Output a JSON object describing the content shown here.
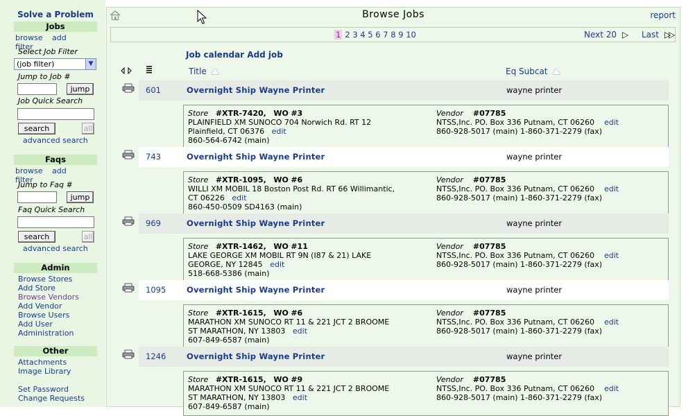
{
  "sidebar": {
    "solve": "Solve a Problem",
    "jobs": {
      "heading": "Jobs",
      "browse": "browse",
      "add": "add",
      "filter": "filter",
      "select_label": "Select Job Filter",
      "select_value": "(job filter)",
      "jump_label": "Jump to Job #",
      "jump_button": "jump",
      "quick_label": "Job Quick Search",
      "search_button": "search",
      "all_button": "all",
      "advanced": "advanced search"
    },
    "faqs": {
      "heading": "Faqs",
      "browse": "browse",
      "add": "add",
      "filter": "filter",
      "jump_label": "Jump to Faq #",
      "jump_button": "jump",
      "quick_label": "Faq Quick Search",
      "search_button": "search",
      "all_button": "all",
      "advanced": "advanced search"
    },
    "admin": {
      "heading": "Admin",
      "links": [
        "Browse Stores",
        "Add Store",
        "Browse Vendors",
        "Add Vendor",
        "Browse Users",
        "Add User",
        "Administration"
      ]
    },
    "other": {
      "heading": "Other",
      "links": [
        "Attachments",
        "Image Library",
        "Set Password",
        "Change Requests"
      ]
    }
  },
  "header": {
    "title": "Browse Jobs",
    "report": "report"
  },
  "pager": {
    "pages": [
      "1",
      "2",
      "3",
      "4",
      "5",
      "6",
      "7",
      "8",
      "9",
      "10"
    ],
    "current": "1",
    "next": "Next 20",
    "last": "Last"
  },
  "actions": {
    "calendar": "Job calendar",
    "add_job": "Add job"
  },
  "columns": {
    "title": "Title",
    "eq_subcat": "Eq Subcat"
  },
  "jobs": [
    {
      "id": "601",
      "title": "Overnight Ship Wayne Printer",
      "subcat": "wayne printer",
      "store_label": "Store",
      "store": "#XTR-7420,",
      "wo_label": "WO",
      "wo": "#3",
      "store_line1": "PLAINFIELD XM SUNOCO  704 Norwich Rd. RT 12",
      "store_line2": "Plainfield, CT  06376",
      "store_phone": "860-564-6742 (main)",
      "edit": "edit",
      "vendor_label": "Vendor",
      "vendor": "#07785",
      "vendor_line1": "NTSS,Inc.  PO. Box 336 Putnam, CT  06260",
      "vendor_phone": "860-928-5017 (main)   1-860-371-2279 (fax)"
    },
    {
      "id": "743",
      "title": "Overnight Ship Wayne Printer",
      "subcat": "wayne printer",
      "store_label": "Store",
      "store": "#XTR-1095,",
      "wo_label": "WO",
      "wo": "#6",
      "store_line1": "WILLI XM MOBIL  18 Boston Post Rd. RT 66 Willimantic,",
      "store_line2": "CT  06226",
      "store_phone": "860-450-0509 SD4163 (main)",
      "edit": "edit",
      "vendor_label": "Vendor",
      "vendor": "#07785",
      "vendor_line1": "NTSS,Inc.  PO. Box 336 Putnam, CT  06260",
      "vendor_phone": "860-928-5017 (main)   1-860-371-2279 (fax)"
    },
    {
      "id": "969",
      "title": "Overnight Ship Wayne Printer",
      "subcat": "wayne printer",
      "store_label": "Store",
      "store": "#XTR-1462,",
      "wo_label": "WO",
      "wo": "#11",
      "store_line1": "LAKE GEORGE XM MOBIL  RT 9N (I87 & 21) LAKE",
      "store_line2": "GEORGE, NY  12845",
      "store_phone": "518-668-5386 (main)",
      "edit": "edit",
      "vendor_label": "Vendor",
      "vendor": "#07785",
      "vendor_line1": "NTSS,Inc.  PO. Box 336 Putnam, CT  06260",
      "vendor_phone": "860-928-5017 (main)   1-860-371-2279 (fax)"
    },
    {
      "id": "1095",
      "title": "Overnight Ship Wayne Printer",
      "subcat": "wayne printer",
      "store_label": "Store",
      "store": "#XTR-1615,",
      "wo_label": "WO",
      "wo": "#6",
      "store_line1": "MARATHON XM SUNOCO  RT 11 & 221 JCT 2 BROOME",
      "store_line2": "ST MARATHON, NY  13803",
      "store_phone": "607-849-6587 (main)",
      "edit": "edit",
      "vendor_label": "Vendor",
      "vendor": "#07785",
      "vendor_line1": "NTSS,Inc.  PO. Box 336 Putnam, CT  06260",
      "vendor_phone": "860-928-5017 (main)   1-860-371-2279 (fax)"
    },
    {
      "id": "1246",
      "title": "Overnight Ship Wayne Printer",
      "subcat": "wayne printer",
      "store_label": "Store",
      "store": "#XTR-1615,",
      "wo_label": "WO",
      "wo": "#9",
      "store_line1": "MARATHON XM SUNOCO  RT 11 & 221 JCT 2 BROOME",
      "store_line2": "ST MARATHON, NY  13803",
      "store_phone": "607-849-6587 (main)",
      "edit": "edit",
      "vendor_label": "Vendor",
      "vendor": "#07785",
      "vendor_line1": "NTSS,Inc.  PO. Box 336 Putnam, CT  06260",
      "vendor_phone": "860-928-5017 (main)   1-860-371-2279 (fax)"
    }
  ]
}
